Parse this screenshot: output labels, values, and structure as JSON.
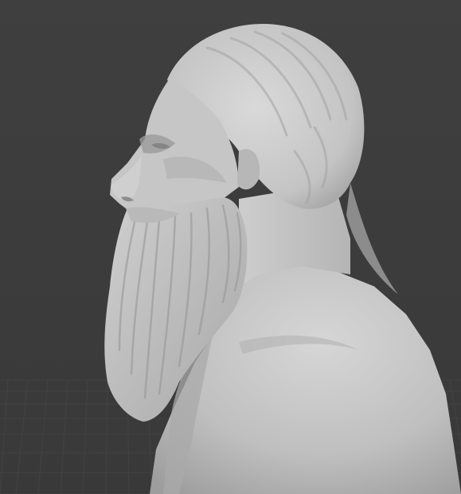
{
  "viewport": {
    "shading": "solid",
    "background_color": "#3d3d3d",
    "grid_line_color": "#4a4a4a",
    "model_color": "#c9c9c9",
    "model_shadow_color": "#8f8f8f",
    "model_highlight_color": "#e2e2e2",
    "model_name": "sculpted-bust-bearded-man"
  }
}
